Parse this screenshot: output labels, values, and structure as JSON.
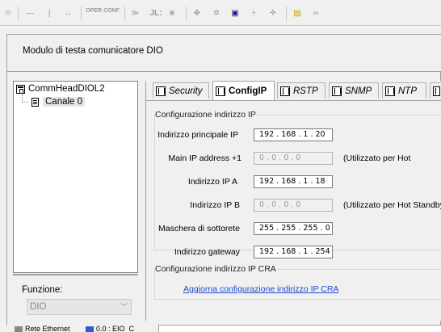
{
  "toolbar": {
    "oper_label": "OPER",
    "conf_label": "CONF",
    "jl_label": "JL:"
  },
  "window": {
    "title": "Modulo di testa comunicatore DIO"
  },
  "tree": {
    "root_label": "CommHeadDIOL2",
    "child_label": "Canale 0"
  },
  "function": {
    "label": "Funzione:",
    "value": "DIO"
  },
  "tabs": [
    {
      "label": "Security"
    },
    {
      "label": "ConfigIP"
    },
    {
      "label": "RSTP"
    },
    {
      "label": "SNMP"
    },
    {
      "label": "NTP"
    }
  ],
  "config_ip": {
    "group_title": "Configurazione indirizzo IP",
    "rows": [
      {
        "label": "Indirizzo principale IP",
        "value": "192 . 168 . 1 . 20",
        "note": ""
      },
      {
        "label": "Main IP address +1",
        "value": "0 . 0 . 0 . 0",
        "note": "(Utilizzato per Hot"
      },
      {
        "label": "Indirizzo IP A",
        "value": "192 . 168 . 1 . 18",
        "note": ""
      },
      {
        "label": "Indirizzo IP B",
        "value": "0 . 0 . 0 . 0",
        "note": "(Utilizzato per Hot Standby)"
      },
      {
        "label": "Maschera di sottorete",
        "value": "255 . 255 . 255 . 0",
        "note": ""
      },
      {
        "label": "Indirizzo gateway",
        "value": "192 . 168 . 1 . 254",
        "note": ""
      }
    ]
  },
  "config_cra": {
    "group_title": "Configurazione indirizzo IP CRA",
    "link": "Aggiorna configurazione indirizzo IP CRA"
  },
  "bottom_tabs": [
    {
      "label": "Rete Ethernet"
    },
    {
      "label": "0.0 : EIO_C"
    }
  ],
  "colors": {
    "link": "#1c4bd0",
    "window_bg": "#f0f0f0"
  }
}
